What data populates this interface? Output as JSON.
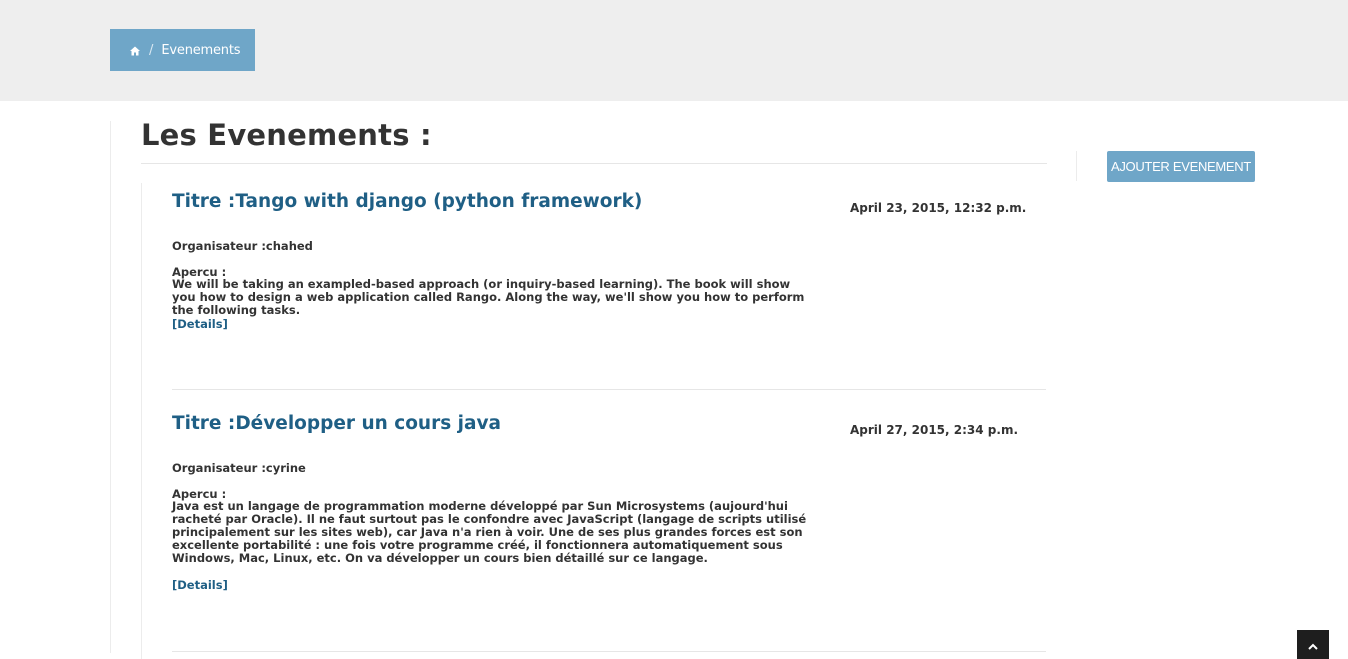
{
  "breadcrumb": {
    "home_icon": "home-icon",
    "separator": "/",
    "current": "Evenements"
  },
  "page": {
    "title": "Les Evenements :"
  },
  "sidebar": {
    "add_button_label": "Ajouter Evenement"
  },
  "events": [
    {
      "title": "Titre :Tango with django (python framework)",
      "date": "April 23, 2015, 12:32 p.m.",
      "organizer": "Organisateur :chahed",
      "overview_label": "Apercu :",
      "overview": "We will be taking an exampled-based approach (or inquiry-based learning). The book will show you how to design a web application called Rango. Along the way, we'll show you how to perform the following tasks.",
      "details_label": "[Details]"
    },
    {
      "title": "Titre :Développer un cours java",
      "date": "April 27, 2015, 2:34 p.m.",
      "organizer": "Organisateur :cyrine",
      "overview_label": "Apercu :",
      "overview": "Java est un langage de programmation moderne développé par Sun Microsystems (aujourd'hui racheté par Oracle). Il ne faut surtout pas le confondre avec JavaScript (langage de scripts utilisé principalement sur les sites web), car Java n'a rien à voir. Une de ses plus grandes forces est son excellente portabilité : une fois votre programme créé, il fonctionnera automatiquement sous Windows, Mac, Linux, etc. On va développer un cours bien détaillé sur ce langage.",
      "details_label": "[Details]"
    }
  ],
  "scroll_top": {
    "icon": "chevron-up-icon"
  },
  "colors": {
    "accent": "#6fa6c8",
    "link": "#1f5f85",
    "band": "#eeeeee"
  }
}
